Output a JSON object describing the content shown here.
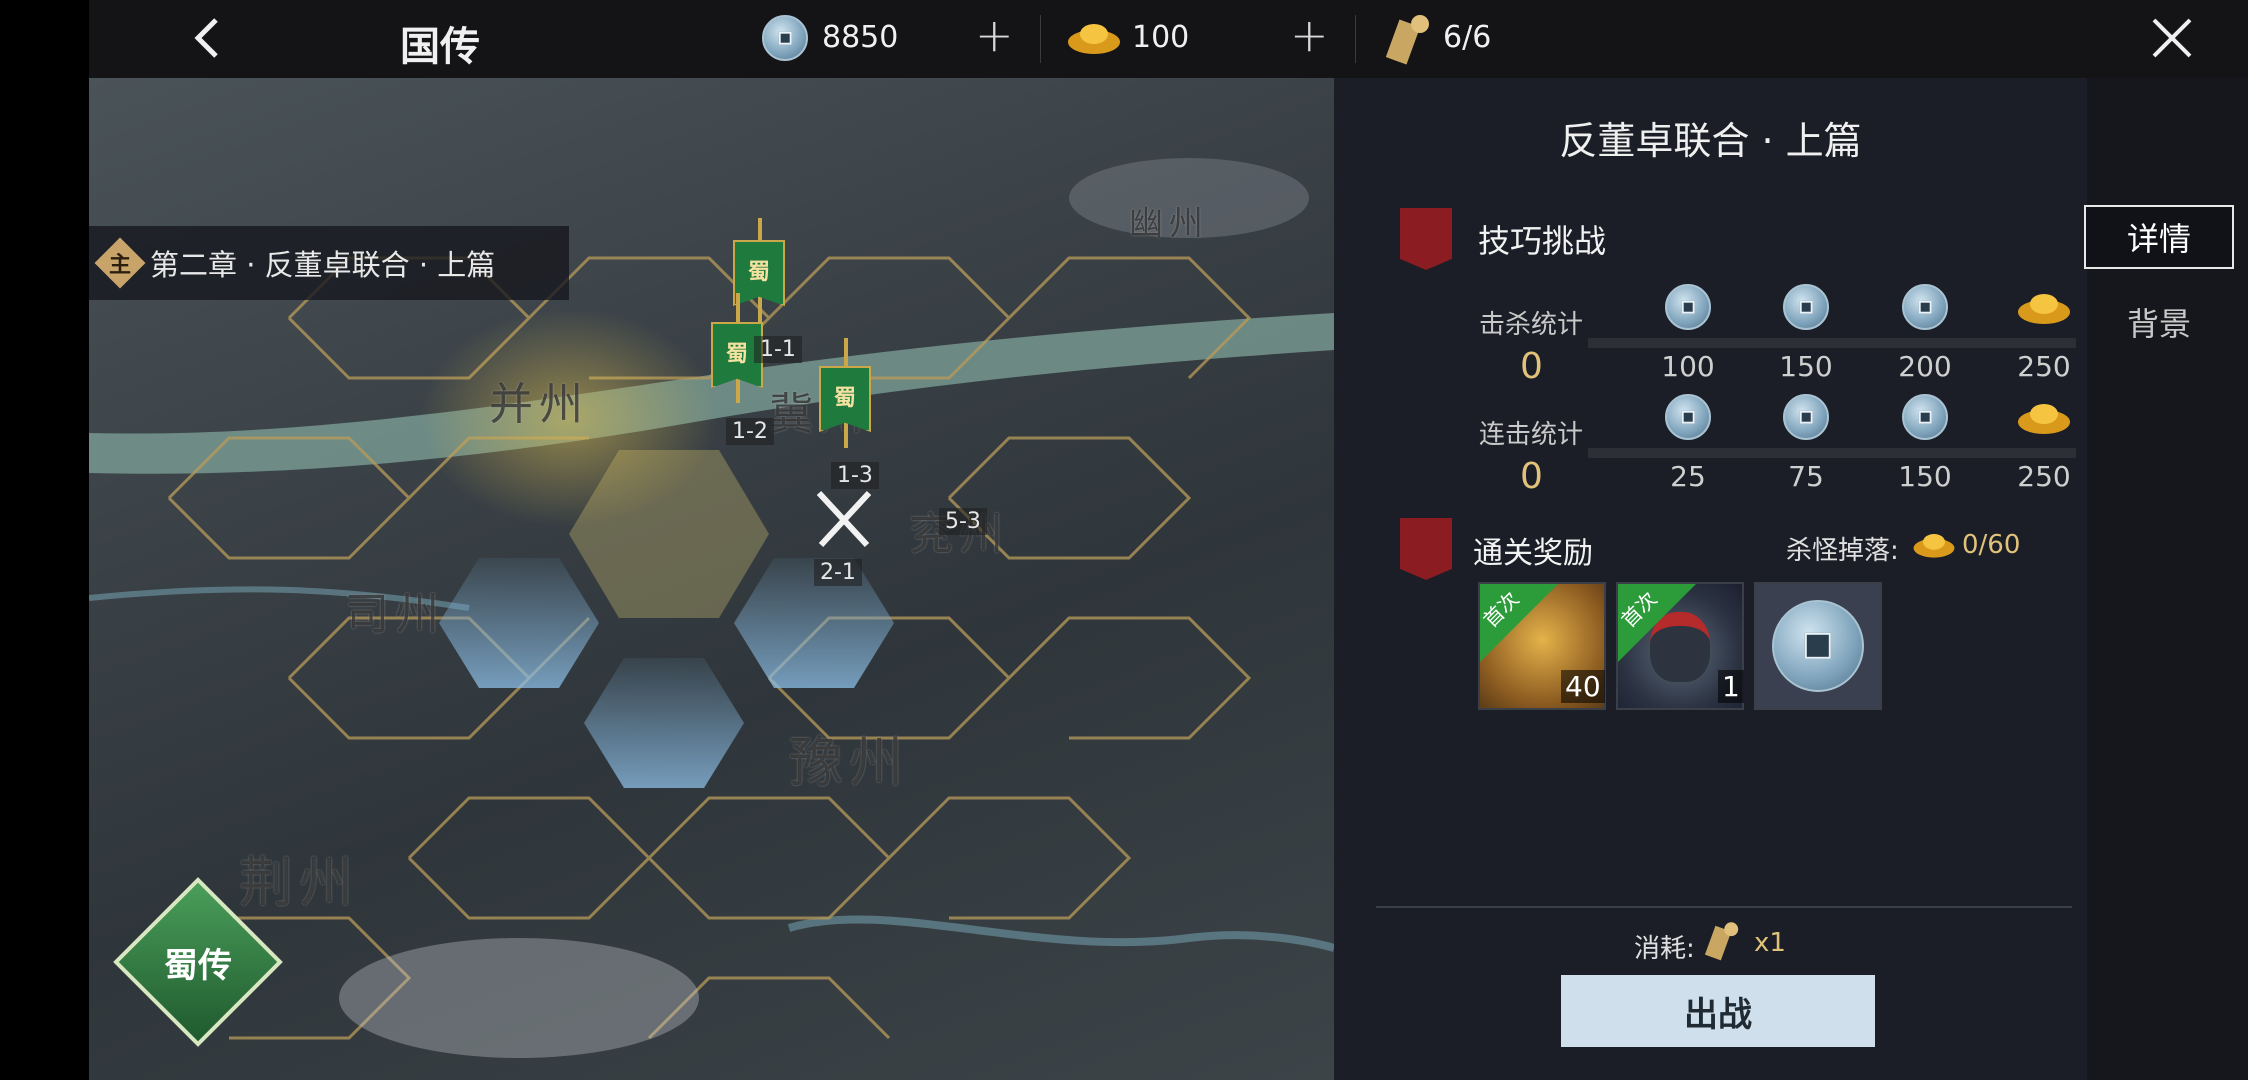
{
  "header": {
    "back_icon": "chevron-left-icon",
    "title": "国传",
    "copper": "8850",
    "gold": "100",
    "stamina": "6/6",
    "close_icon": "close-icon"
  },
  "map": {
    "chapter_label": "第二章 · 反董卓联合 · 上篇",
    "chapter_badge": "主",
    "provinces": {
      "youzhou": "幽州",
      "bingzhou": "并州",
      "jizhou": "冀州",
      "sizhou": "司州",
      "yanzhou": "兖州",
      "yuzhou": "豫州",
      "jingzhou": "荆州"
    },
    "stages": [
      "1-1",
      "1-2",
      "1-3",
      "5-3",
      "2-1"
    ],
    "flag_glyph": "蜀",
    "shu_button": "蜀传"
  },
  "panel": {
    "title": "反董卓联合 · 上篇",
    "challenge": {
      "title": "技巧挑战",
      "kill_label": "击杀统计",
      "kill_value": "0",
      "kill_milestones": [
        "100",
        "150",
        "200",
        "250"
      ],
      "combo_label": "连击统计",
      "combo_value": "0",
      "combo_milestones": [
        "25",
        "75",
        "150",
        "250"
      ]
    },
    "rewards": {
      "title": "通关奖励",
      "drop_label": "杀怪掉落:",
      "drop_value": "0/60",
      "first_tag": "首次",
      "item1_count": "40",
      "item2_count": "1"
    },
    "cost_label": "消耗:",
    "cost_value": "x1",
    "fight_button": "出战"
  },
  "tabs": {
    "details": "详情",
    "background": "背景"
  },
  "colors": {
    "accent_gold": "#e0c27a",
    "flag_green": "#1f7a3e",
    "section_red": "#8a1c22",
    "button_bg": "#cfe0ec"
  }
}
